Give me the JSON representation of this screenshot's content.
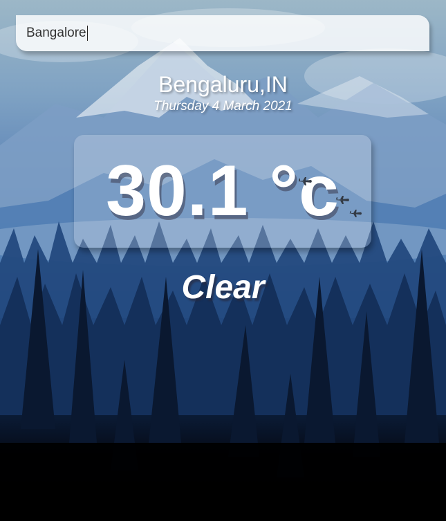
{
  "search": {
    "value": "Bangalore"
  },
  "location": {
    "name": "Bengaluru,IN",
    "date": "Thursday 4 March 2021"
  },
  "temperature": {
    "display": "30.1 °c"
  },
  "weather": {
    "condition": "Clear"
  },
  "icons": {
    "background": "mountain-forest-landscape",
    "decor": "airplane-icon"
  },
  "colors": {
    "sky_top": "#9cb7c7",
    "forest_mid": "#1d3f73",
    "ground": "#000000",
    "text": "#ffffff"
  }
}
